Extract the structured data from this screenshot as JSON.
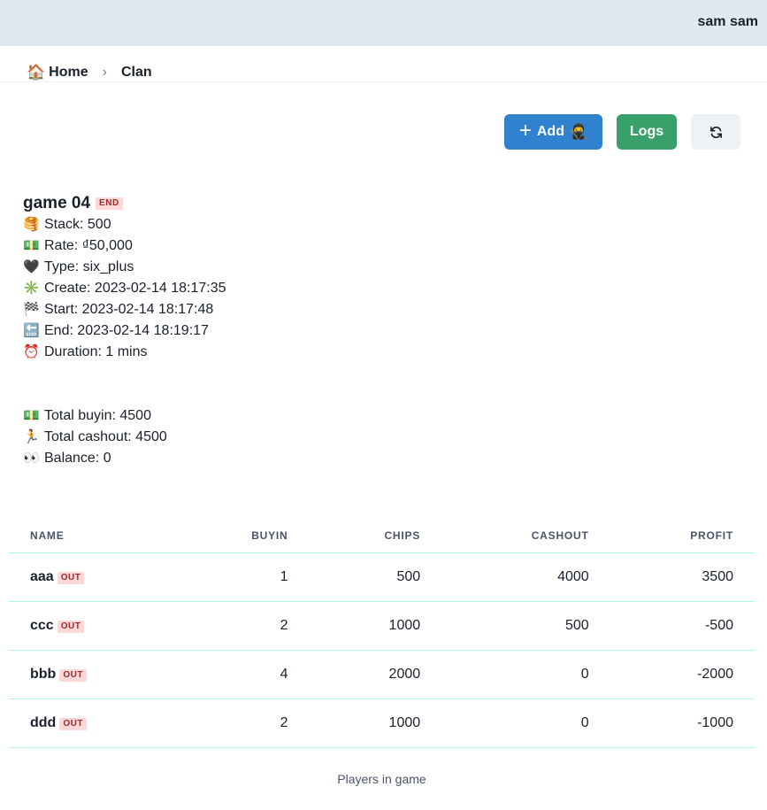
{
  "header": {
    "user": "sam sam"
  },
  "breadcrumb": {
    "home_icon": "🏠",
    "home": "Home",
    "separator": "›",
    "current": "Clan"
  },
  "toolbar": {
    "add_label": "Add",
    "add_icon": "🥷",
    "logs_label": "Logs",
    "refresh_icon": "refresh-icon"
  },
  "game": {
    "title": "game 04",
    "status": "END",
    "details": [
      {
        "emoji": "🥞",
        "text": "Stack: 500"
      },
      {
        "emoji": "💵",
        "text": "Rate: ₫50,000"
      },
      {
        "emoji": "🖤",
        "text": "Type: six_plus"
      },
      {
        "emoji": "✳️",
        "text": "Create: 2023-02-14 18:17:35"
      },
      {
        "emoji": "🏁",
        "text": "Start: 2023-02-14 18:17:48"
      },
      {
        "emoji": "🔚",
        "text": "End: 2023-02-14 18:19:17"
      },
      {
        "emoji": "⏰",
        "text": "Duration: 1 mins"
      }
    ],
    "totals": [
      {
        "emoji": "💵",
        "text": "Total buyin: 4500"
      },
      {
        "emoji": "🏃",
        "text": "Total cashout: 4500"
      },
      {
        "emoji": "👀",
        "text": "Balance: 0"
      }
    ]
  },
  "table": {
    "headers": [
      "NAME",
      "BUYIN",
      "CHIPS",
      "CASHOUT",
      "PROFIT"
    ],
    "rows": [
      {
        "name": "aaa",
        "status": "OUT",
        "buyin": "1",
        "chips": "500",
        "cashout": "4000",
        "profit": "3500"
      },
      {
        "name": "ccc",
        "status": "OUT",
        "buyin": "2",
        "chips": "1000",
        "cashout": "500",
        "profit": "-500"
      },
      {
        "name": "bbb",
        "status": "OUT",
        "buyin": "4",
        "chips": "2000",
        "cashout": "0",
        "profit": "-2000"
      },
      {
        "name": "ddd",
        "status": "OUT",
        "buyin": "2",
        "chips": "1000",
        "cashout": "0",
        "profit": "-1000"
      }
    ],
    "caption": "Players in game"
  }
}
